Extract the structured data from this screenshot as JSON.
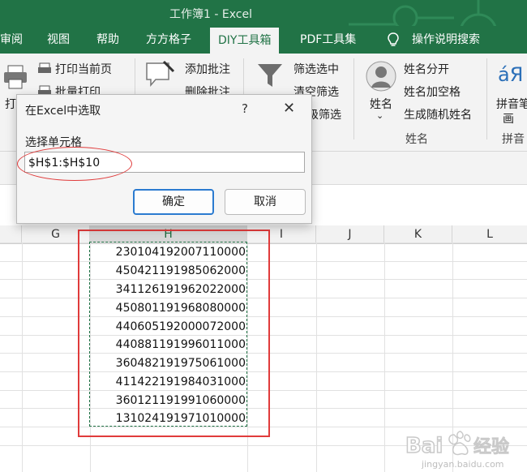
{
  "window": {
    "title": "工作簿1 - Excel"
  },
  "ribbon_tabs": [
    {
      "label": "审阅"
    },
    {
      "label": "视图"
    },
    {
      "label": "帮助"
    },
    {
      "label": "方方格子"
    },
    {
      "label": "DIY工具箱"
    },
    {
      "label": "PDF工具集"
    },
    {
      "label": "操作说明搜索"
    }
  ],
  "ribbon": {
    "print_current_page": "打印当前页",
    "batch_print": "批量打印",
    "print_fragment": "打",
    "add_comment": "添加批注",
    "delete_comment": "删除批注",
    "filter_selected": "筛选选中",
    "clear_filter": "清空筛选",
    "advanced_filter_fragment": "级筛选",
    "name_button": "姓名",
    "name_split": "姓名分开",
    "name_add_space": "姓名加空格",
    "random_name": "生成随机姓名",
    "group_name": "姓名",
    "pinyin_fragment": "拼音笔",
    "pinyin_fragment2": "画",
    "pinyin_group_fragment": "拼音"
  },
  "dialog": {
    "title": "在Excel中选取",
    "help": "?",
    "close": "✕",
    "label": "选择单元格",
    "input_value": "$H$1:$H$10",
    "ok_label": "确定",
    "cancel_label": "取消"
  },
  "sheet": {
    "columns": [
      "G",
      "H",
      "I",
      "J",
      "K",
      "L"
    ],
    "selected_column": "H",
    "values": [
      "230104192007110000",
      "450421191985062000",
      "341126191962022000",
      "450801191968080000",
      "440605192000072000",
      "440881191996011000",
      "360482191975061000",
      "411422191984031000",
      "360121191991060000",
      "131024191971010000"
    ]
  },
  "watermark": {
    "brand": "Bai",
    "brand2": "经验",
    "url": "jingyan.baidu.com"
  },
  "colors": {
    "excel_green": "#217346",
    "highlight_red": "#e03b3b",
    "focus_blue": "#2b7bd0"
  }
}
